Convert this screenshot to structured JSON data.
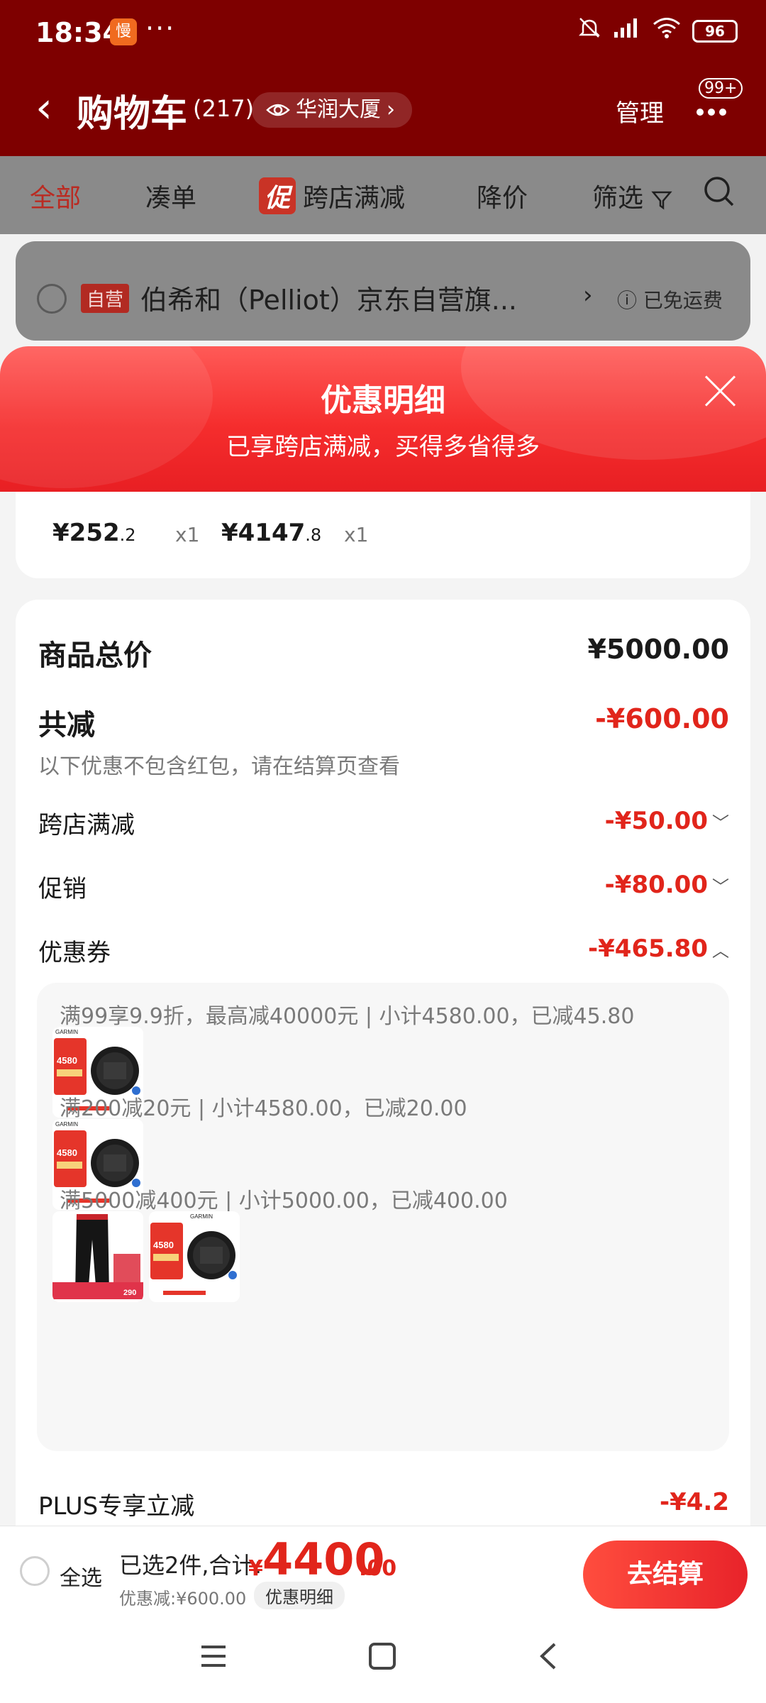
{
  "status_bar": {
    "time": "18:34",
    "app_badge": "慢",
    "dots": "···",
    "battery": "96"
  },
  "header": {
    "back": "‹",
    "title": "购物车",
    "count": "(217)",
    "location_icon": "eye-icon",
    "location": "华润大厦",
    "location_arrow": "›",
    "manage": "管理",
    "more_badge": "99+"
  },
  "tabs": [
    {
      "label": "全部",
      "active": true
    },
    {
      "label": "凑单",
      "active": false
    },
    {
      "label": "跨店满减",
      "promo_mark": "促",
      "active": false
    },
    {
      "label": "降价",
      "active": false
    },
    {
      "label": "筛选",
      "active": false
    }
  ],
  "store": {
    "badge": "自营",
    "name": "伯希和（Pelliot）京东自营旗...",
    "arrow": "›",
    "shipping": "已免运费"
  },
  "sheet": {
    "title": "优惠明细",
    "subtitle": "已享跨店满减，买得多省得多",
    "items": [
      {
        "price_int": "¥252",
        "price_dec": ".2",
        "qty": "x1"
      },
      {
        "price_int": "¥4147",
        "price_dec": ".8",
        "qty": "x1"
      }
    ],
    "total_label": "商品总价",
    "total_value": "¥5000.00",
    "reduce_label": "共减",
    "reduce_value": "-¥600.00",
    "reduce_note": "以下优惠不包含红包，请在结算页查看",
    "cross_store_label": "跨店满减",
    "cross_store_value": "-¥50.00",
    "promo_label": "促销",
    "promo_value": "-¥80.00",
    "coupon_label": "优惠券",
    "coupon_value": "-¥465.80",
    "coupons": [
      {
        "text": "满99享9.9折，最高减40000元 | 小计4580.00，已减45.80"
      },
      {
        "text": "满200减20元 | 小计4580.00，已减20.00"
      },
      {
        "text": "满5000减400元 | 小计5000.00，已减400.00"
      }
    ],
    "thumb_texts": {
      "watch_price": "4580",
      "pants_price": "290",
      "brand": "GARMIN"
    },
    "plus_label": "PLUS专享立减",
    "plus_value": "-¥4.2"
  },
  "bottom": {
    "select_all": "全选",
    "summary": "已选2件,合计:",
    "currency": "¥",
    "total_int": "4400",
    "total_dec": ".00",
    "discount": "优惠减:¥600.00",
    "detail": "优惠明细",
    "checkout": "去结算"
  },
  "nav": {
    "menu": "☰",
    "home": "□",
    "back": "‹"
  }
}
